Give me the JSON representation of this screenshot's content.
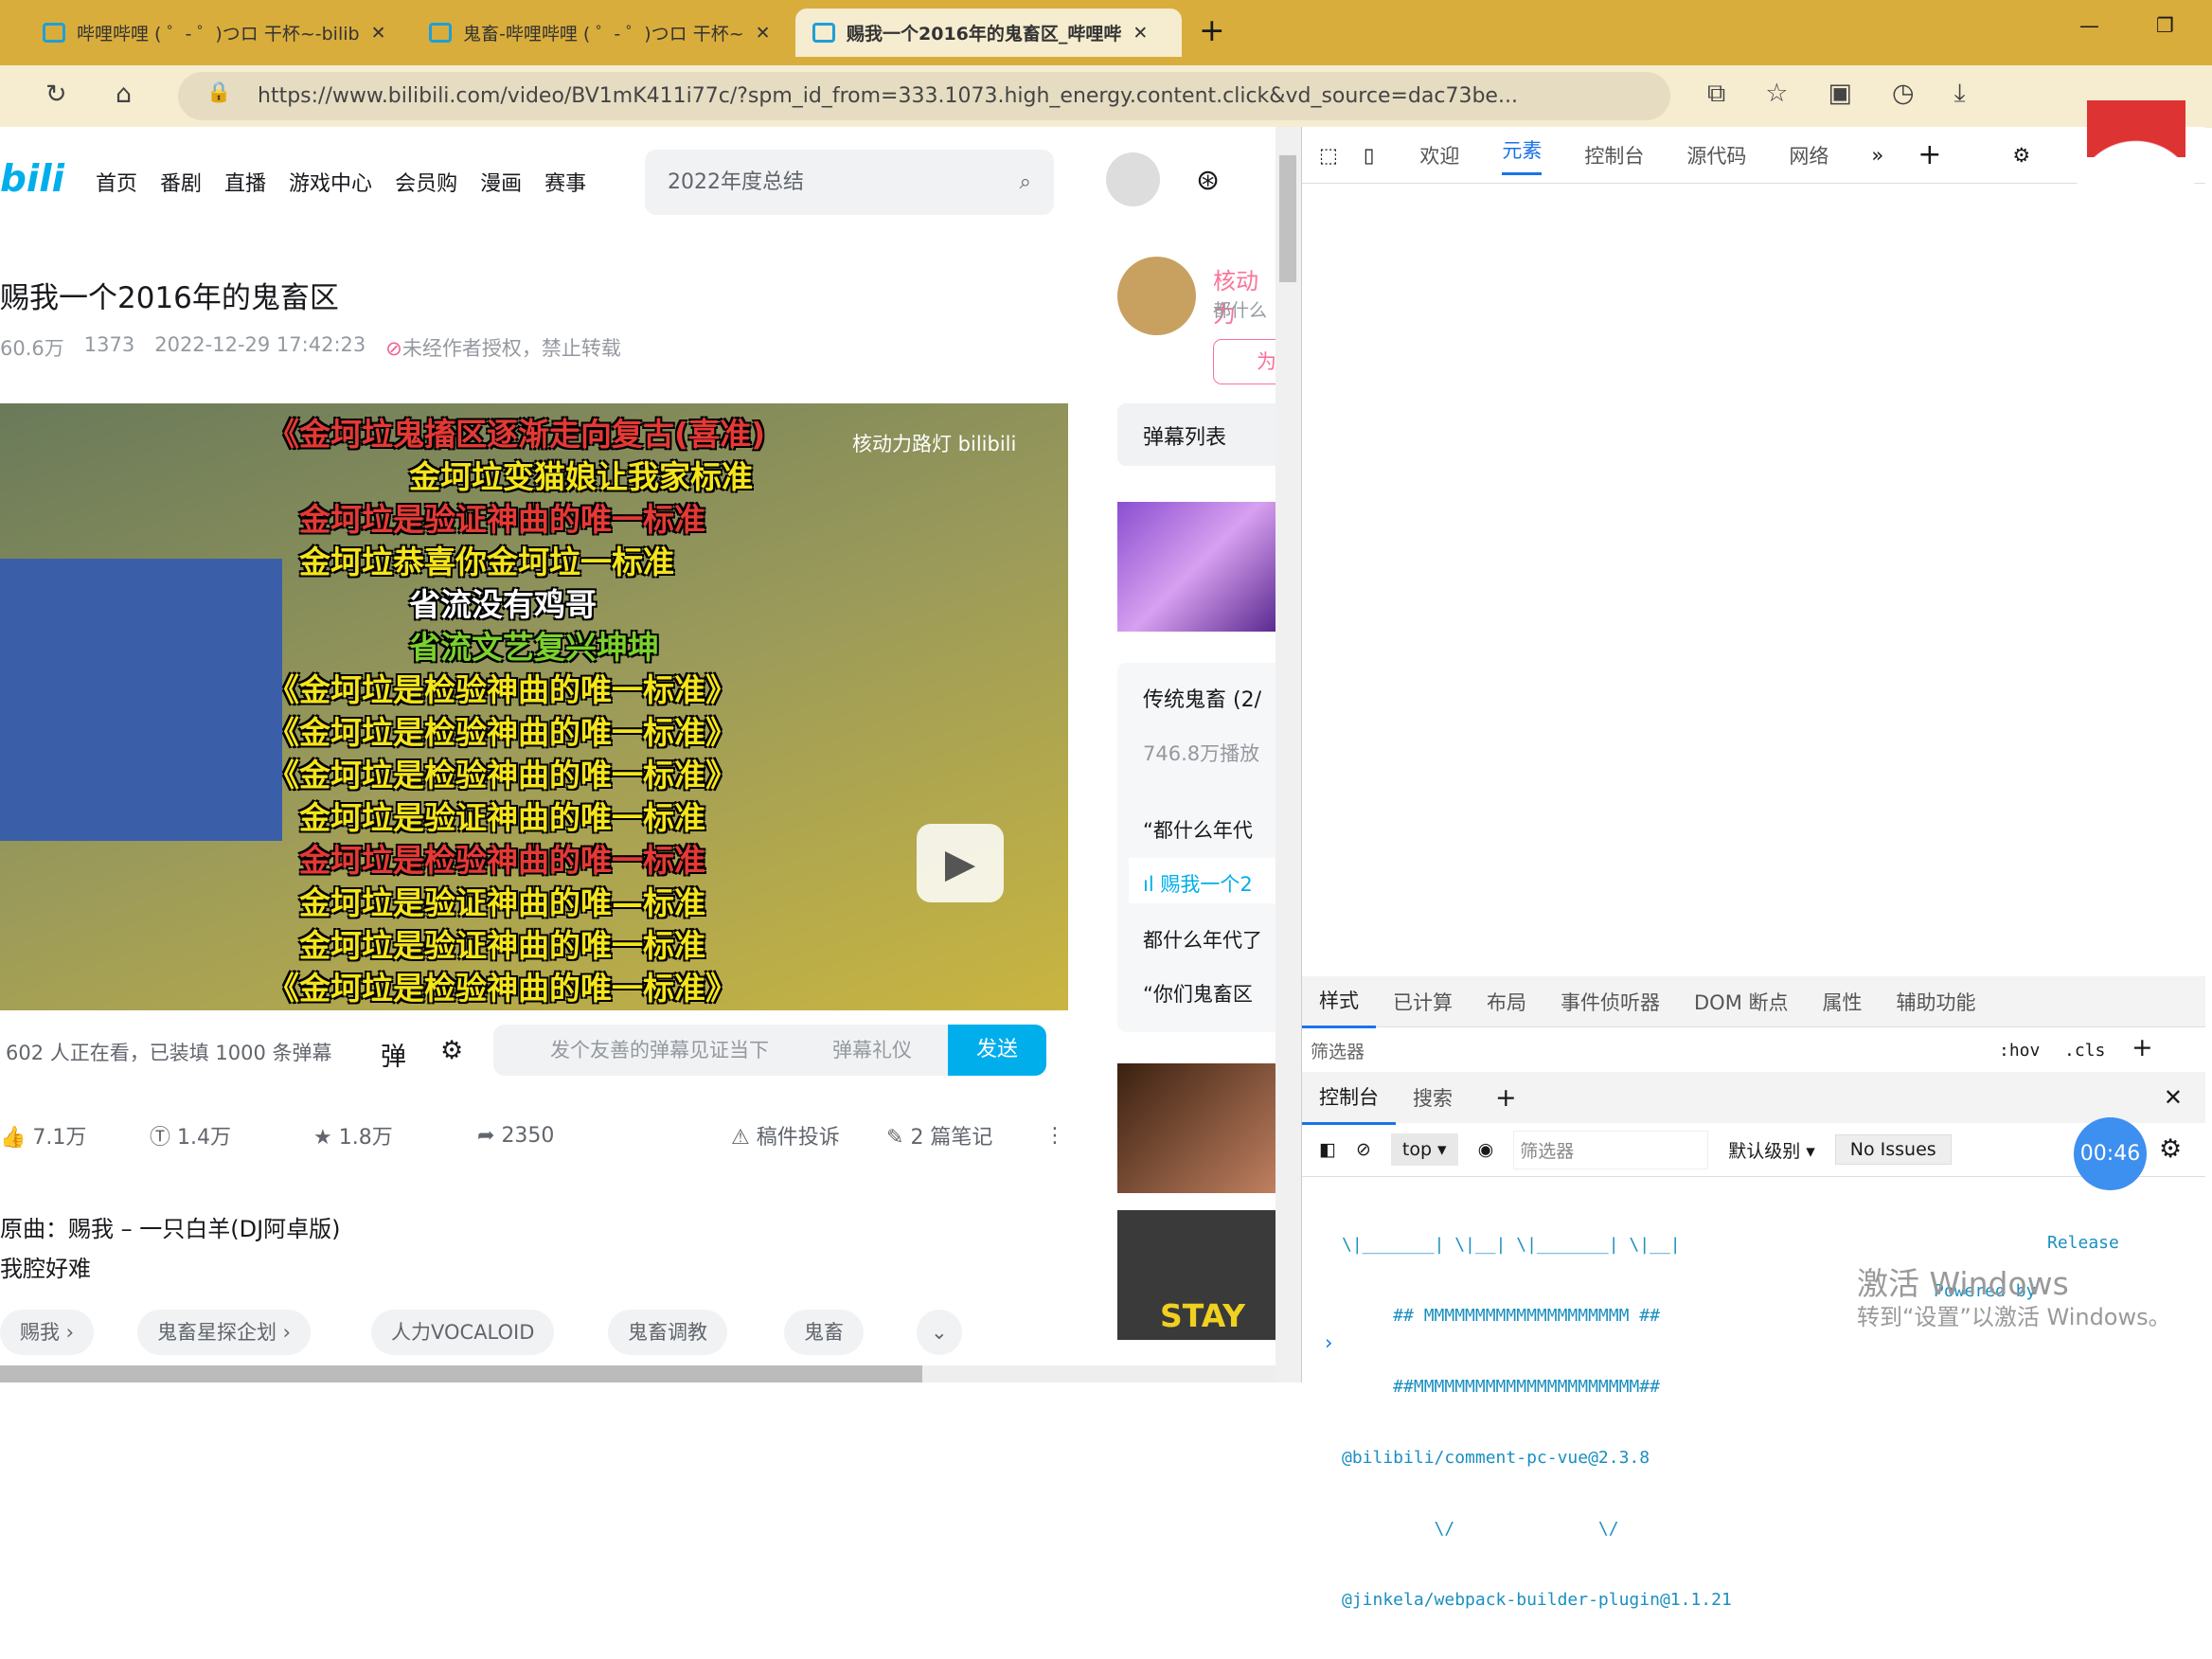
{
  "browser": {
    "tabs": [
      {
        "title": "哔哩哔哩 ( ゜- ゜)つロ 干杯~-bilib"
      },
      {
        "title": "鬼畜-哔哩哔哩 ( ゜- ゜)つロ 干杯~"
      },
      {
        "title": "赐我一个2016年的鬼畜区_哔哩哔"
      }
    ],
    "url": "https://www.bilibili.com/video/BV1mK411i77c/?spm_id_from=333.1073.high_energy.content.click&vd_source=dac73be..."
  },
  "site": {
    "logo": "bilibili",
    "nav": [
      "首页",
      "番剧",
      "直播",
      "游戏中心",
      "会员购",
      "漫画",
      "赛事"
    ],
    "search_placeholder": "2022年度总结"
  },
  "video": {
    "title": "赐我一个2016年的鬼畜区",
    "views": "60.6万",
    "danmaku_count": "1373",
    "date": "2022-12-29 17:42:23",
    "copyright": "未经作者授权，禁止转载",
    "watermark": "核动力路灯 bilibili",
    "danmaku": [
      {
        "text": "《金坷垃鬼搐区逐渐走向复古(喜准)",
        "color": "#e53935"
      },
      {
        "text": "金坷垃变猫娘让我家标准",
        "color": "#f5e51b"
      },
      {
        "text": "金坷垃是验证神曲的唯一标准",
        "color": "#e53935"
      },
      {
        "text": "金坷垃恭喜你金坷垃一标准",
        "color": "#f5e51b"
      },
      {
        "text": "省流没有鸡哥",
        "color": "#ffffff"
      },
      {
        "text": "省流文艺复兴坤坤",
        "color": "#7cd12e"
      },
      {
        "text": "《金坷垃是检验神曲的唯一标准》",
        "color": "#f5e51b"
      },
      {
        "text": "《金坷垃是检验神曲的唯一标准》",
        "color": "#f5e51b"
      },
      {
        "text": "《金坷垃是检验神曲的唯一标准》",
        "color": "#f5e51b"
      },
      {
        "text": "金坷垃是验证神曲的唯一标准",
        "color": "#f5e51b"
      },
      {
        "text": "金坷垃是检验神曲的唯一标准",
        "color": "#e53935"
      },
      {
        "text": "金坷垃是验证神曲的唯—标准",
        "color": "#f5e51b"
      },
      {
        "text": "金坷垃是验证神曲的唯一标准",
        "color": "#f5e51b"
      },
      {
        "text": "《金坷垃是检验神曲的唯一标准》",
        "color": "#f5e51b"
      }
    ],
    "viewers": "602 人正在看，已装填 1000 条弹幕",
    "danmaku_placeholder": "发个友善的弹幕见证当下",
    "etiquette": "弹幕礼仪",
    "send": "发送",
    "likes": "7.1万",
    "coins": "1.4万",
    "favorites": "1.8万",
    "shares": "2350",
    "report": "稿件投诉",
    "notes": "2 篇笔记",
    "desc_line1": "原曲：赐我 – 一只白羊(DJ阿卓版)",
    "desc_line2": "我腔好难",
    "tags": [
      "赐我",
      "鬼畜星探企划",
      "人力VOCALOID",
      "鬼畜调教",
      "鬼畜"
    ]
  },
  "sidebar": {
    "uploader": "核动力",
    "uploader_sign": "都什么",
    "follow": "为",
    "danmaku_list": "弹幕列表",
    "collection": "传统鬼畜 (2/",
    "collection_plays": "746.8万播放",
    "items": [
      "“都什么年代",
      "赐我一个2",
      "都什么年代了",
      "“你们鬼畜区"
    ],
    "thumb_text": "STAY"
  },
  "devtools": {
    "tabs": [
      "欢迎",
      "元素",
      "控制台",
      "源代码",
      "网络"
    ],
    "active_tab": "元素",
    "style_tabs": [
      "样式",
      "已计算",
      "布局",
      "事件侦听器",
      "DOM 断点",
      "属性",
      "辅助功能"
    ],
    "filter": "筛选器",
    "hov": ":hov",
    "cls": ".cls",
    "drawer_tabs": [
      "控制台",
      "搜索"
    ],
    "context": "top",
    "console_filter": "筛选器",
    "level": "默认级别",
    "issues": "No Issues",
    "console_lines": [
      "\\|_______| \\|__| \\|_______| \\|__|",
      "     ## MMMMMMMMMMMMMMMMMMMM ##",
      "     ##MMMMMMMMMMMMMMMMMMMMMM##",
      "@bilibili/comment-pc-vue@2.3.8",
      "         \\/              \\/",
      "@jinkela/webpack-builder-plugin@1.1.21"
    ],
    "release": "Release",
    "powered": "Powered by"
  },
  "overlay": {
    "timer": "00:46",
    "activate_title": "激活 Windows",
    "activate_sub": "转到“设置”以激活 Windows。"
  }
}
